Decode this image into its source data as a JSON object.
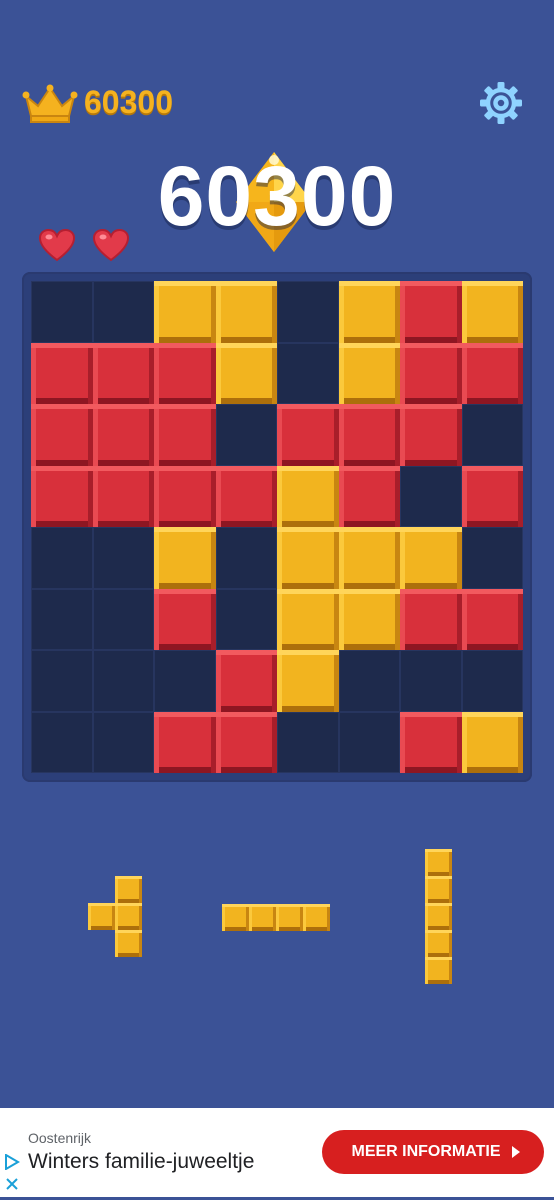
{
  "header": {
    "best_score": "60300",
    "best_score_icon": "crown-icon",
    "settings_icon": "gear-icon"
  },
  "score": {
    "current": "60300",
    "decoration_icon": "diamond-icon"
  },
  "lives": {
    "count": 2,
    "icon": "heart-icon"
  },
  "colors": {
    "background": "#3b5296",
    "board": "#2c3f79",
    "empty_cell": "#1e2a4c",
    "red_block": "#d8303b",
    "yellow_block": "#f2b41f",
    "best_score_text": "#f5b21f",
    "cta": "#d71f1f"
  },
  "board": {
    "rows": [
      [
        "e",
        "e",
        "y",
        "y",
        "e",
        "y",
        "r",
        "y"
      ],
      [
        "r",
        "r",
        "r",
        "y",
        "e",
        "y",
        "r",
        "r"
      ],
      [
        "r",
        "r",
        "r",
        "e",
        "r",
        "r",
        "r",
        "e"
      ],
      [
        "r",
        "r",
        "r",
        "r",
        "y",
        "r",
        "e",
        "r"
      ],
      [
        "e",
        "e",
        "y",
        "e",
        "y",
        "y",
        "y",
        "e"
      ],
      [
        "e",
        "e",
        "r",
        "e",
        "y",
        "y",
        "r",
        "r"
      ],
      [
        "e",
        "e",
        "e",
        "r",
        "y",
        "e",
        "e",
        "e"
      ],
      [
        "e",
        "e",
        "r",
        "r",
        "e",
        "e",
        "r",
        "y"
      ]
    ]
  },
  "tray": {
    "pieces": [
      {
        "name": "t-piece",
        "color": "yellow",
        "cells": [
          [
            1,
            0
          ],
          [
            0,
            1
          ],
          [
            1,
            1
          ],
          [
            1,
            2
          ]
        ]
      },
      {
        "name": "i-horizontal-piece",
        "color": "yellow",
        "cells": [
          [
            0,
            0
          ],
          [
            1,
            0
          ],
          [
            2,
            0
          ],
          [
            3,
            0
          ]
        ]
      },
      {
        "name": "i-vertical-piece",
        "color": "yellow",
        "cells": [
          [
            0,
            0
          ],
          [
            0,
            1
          ],
          [
            0,
            2
          ],
          [
            0,
            3
          ],
          [
            0,
            4
          ]
        ]
      }
    ]
  },
  "ad": {
    "country": "Oostenrijk",
    "title": "Winters familie-juweeltje",
    "cta_label": "MEER INFORMATIE",
    "play_icon": "ad-choices-icon",
    "close_icon": "close-icon"
  }
}
